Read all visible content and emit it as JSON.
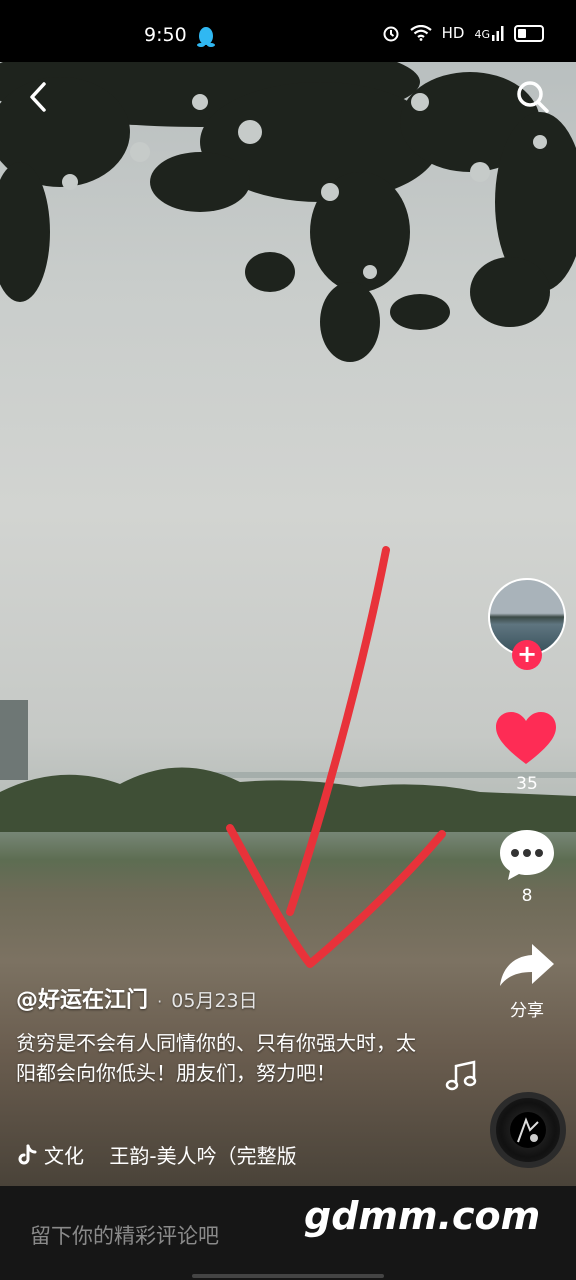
{
  "status_bar": {
    "time": "9:50",
    "network": "HD",
    "signal_label": "4G"
  },
  "icons": {
    "back": "chevron-left-icon",
    "search": "search-icon",
    "like": "heart-icon",
    "comment": "comment-bubble-icon",
    "share": "share-arrow-icon",
    "music_note": "music-note-icon",
    "douyin_logo": "douyin-logo-icon"
  },
  "rail": {
    "follow_symbol": "+",
    "likes": "35",
    "comments": "8",
    "share_label": "分享"
  },
  "post": {
    "username": "@好运在江门",
    "date": "05月23日",
    "description": "贫穷是不会有人同情你的、只有你强大时，太阳都会向你低头！朋友们，努力吧！",
    "music": "文化    王韵-美人吟（完整版"
  },
  "comment_bar": {
    "placeholder": "留下你的精彩评论吧"
  },
  "watermark": "gdmm.com",
  "colors": {
    "like": "#fe2c55",
    "follow": "#fe2c55",
    "annotation_arrow": "#e8323a"
  }
}
